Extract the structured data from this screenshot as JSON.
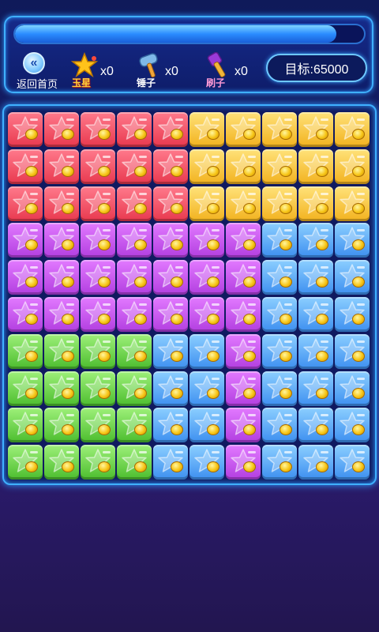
{
  "progress_percent": 92,
  "back_button": {
    "label": "返回首页",
    "icon": "double-chevron-left-icon"
  },
  "tools": [
    {
      "name": "玉星",
      "count": "x0",
      "icon": "magic-star-icon"
    },
    {
      "name": "锤子",
      "count": "x0",
      "icon": "hammer-icon"
    },
    {
      "name": "刷子",
      "count": "x0",
      "icon": "brush-icon"
    }
  ],
  "target_label": "目标:65000",
  "colors": {
    "red": "#e8384e",
    "yellow": "#f2b21e",
    "purple": "#b23ee0",
    "blue": "#3d8ff0",
    "green": "#4cbd2e",
    "accent": "#3fb0ff"
  },
  "grid": [
    [
      "red",
      "red",
      "red",
      "red",
      "red",
      "yellow",
      "yellow",
      "yellow",
      "yellow",
      "yellow"
    ],
    [
      "red",
      "red",
      "red",
      "red",
      "red",
      "yellow",
      "yellow",
      "yellow",
      "yellow",
      "yellow"
    ],
    [
      "red",
      "red",
      "red",
      "red",
      "red",
      "yellow",
      "yellow",
      "yellow",
      "yellow",
      "yellow"
    ],
    [
      "purple",
      "purple",
      "purple",
      "purple",
      "purple",
      "purple",
      "purple",
      "blue",
      "blue",
      "blue"
    ],
    [
      "purple",
      "purple",
      "purple",
      "purple",
      "purple",
      "purple",
      "purple",
      "blue",
      "blue",
      "blue"
    ],
    [
      "purple",
      "purple",
      "purple",
      "purple",
      "purple",
      "purple",
      "purple",
      "blue",
      "blue",
      "blue"
    ],
    [
      "green",
      "green",
      "green",
      "green",
      "blue",
      "blue",
      "purple",
      "blue",
      "blue",
      "blue"
    ],
    [
      "green",
      "green",
      "green",
      "green",
      "blue",
      "blue",
      "purple",
      "blue",
      "blue",
      "blue"
    ],
    [
      "green",
      "green",
      "green",
      "green",
      "blue",
      "blue",
      "purple",
      "blue",
      "blue",
      "blue"
    ],
    [
      "green",
      "green",
      "green",
      "green",
      "blue",
      "blue",
      "purple",
      "blue",
      "blue",
      "blue"
    ]
  ]
}
